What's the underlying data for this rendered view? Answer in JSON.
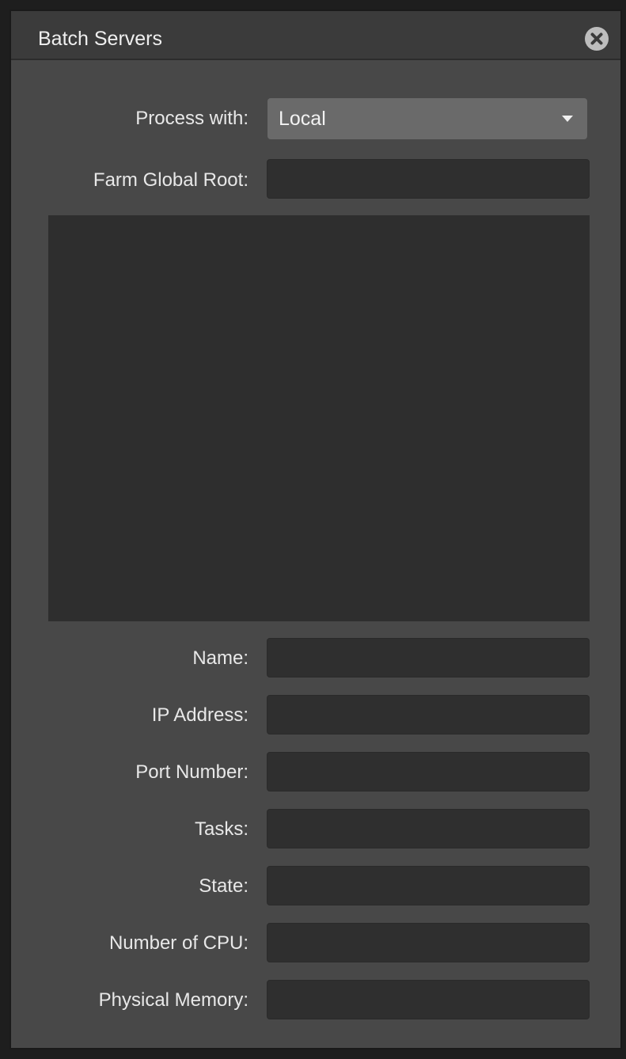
{
  "window": {
    "title": "Batch Servers"
  },
  "process_with": {
    "label": "Process with:",
    "value": "Local"
  },
  "farm_global_root": {
    "label": "Farm Global Root:",
    "value": ""
  },
  "details": {
    "name_label": "Name:",
    "ip_label": "IP Address:",
    "port_label": "Port Number:",
    "tasks_label": "Tasks:",
    "state_label": "State:",
    "cpu_label": "Number of CPU:",
    "memory_label": "Physical Memory:"
  },
  "icons": {
    "close": "close-icon",
    "dropdown": "chevron-down-icon"
  },
  "colors": {
    "panel": "#484848",
    "titlebar": "#3b3b3b",
    "field": "#2f2f2f",
    "dropdown": "#6a6a6a",
    "text": "#e8e8e8"
  }
}
